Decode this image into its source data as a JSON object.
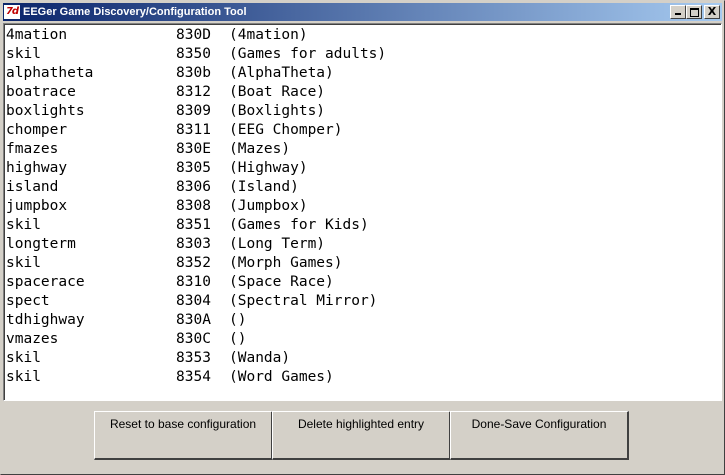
{
  "window": {
    "title": "EEGer Game Discovery/Configuration Tool",
    "icon_text": "7d",
    "controls": {
      "minimize": "_",
      "maximize": "□",
      "close": "X"
    }
  },
  "entries": [
    {
      "name": "4mation",
      "code": "830D",
      "desc": "(4mation)"
    },
    {
      "name": "skil",
      "code": "8350",
      "desc": "(Games for adults)"
    },
    {
      "name": "alphatheta",
      "code": "830b",
      "desc": "(AlphaTheta)"
    },
    {
      "name": "boatrace",
      "code": "8312",
      "desc": "(Boat Race)"
    },
    {
      "name": "boxlights",
      "code": "8309",
      "desc": "(Boxlights)"
    },
    {
      "name": "chomper",
      "code": "8311",
      "desc": "(EEG Chomper)"
    },
    {
      "name": "fmazes",
      "code": "830E",
      "desc": "(Mazes)"
    },
    {
      "name": "highway",
      "code": "8305",
      "desc": "(Highway)"
    },
    {
      "name": "island",
      "code": "8306",
      "desc": "(Island)"
    },
    {
      "name": "jumpbox",
      "code": "8308",
      "desc": "(Jumpbox)"
    },
    {
      "name": "skil",
      "code": "8351",
      "desc": "(Games for Kids)"
    },
    {
      "name": "longterm",
      "code": "8303",
      "desc": "(Long Term)"
    },
    {
      "name": "skil",
      "code": "8352",
      "desc": "(Morph Games)"
    },
    {
      "name": "spacerace",
      "code": "8310",
      "desc": "(Space Race)"
    },
    {
      "name": "spect",
      "code": "8304",
      "desc": "(Spectral Mirror)"
    },
    {
      "name": "tdhighway",
      "code": "830A",
      "desc": "()"
    },
    {
      "name": "vmazes",
      "code": "830C",
      "desc": "()"
    },
    {
      "name": "skil",
      "code": "8353",
      "desc": "(Wanda)"
    },
    {
      "name": "skil",
      "code": "8354",
      "desc": "(Word Games)"
    }
  ],
  "buttons": {
    "reset": "Reset to base configuration",
    "delete": "Delete highlighted entry",
    "done": "Done-Save Configuration"
  }
}
